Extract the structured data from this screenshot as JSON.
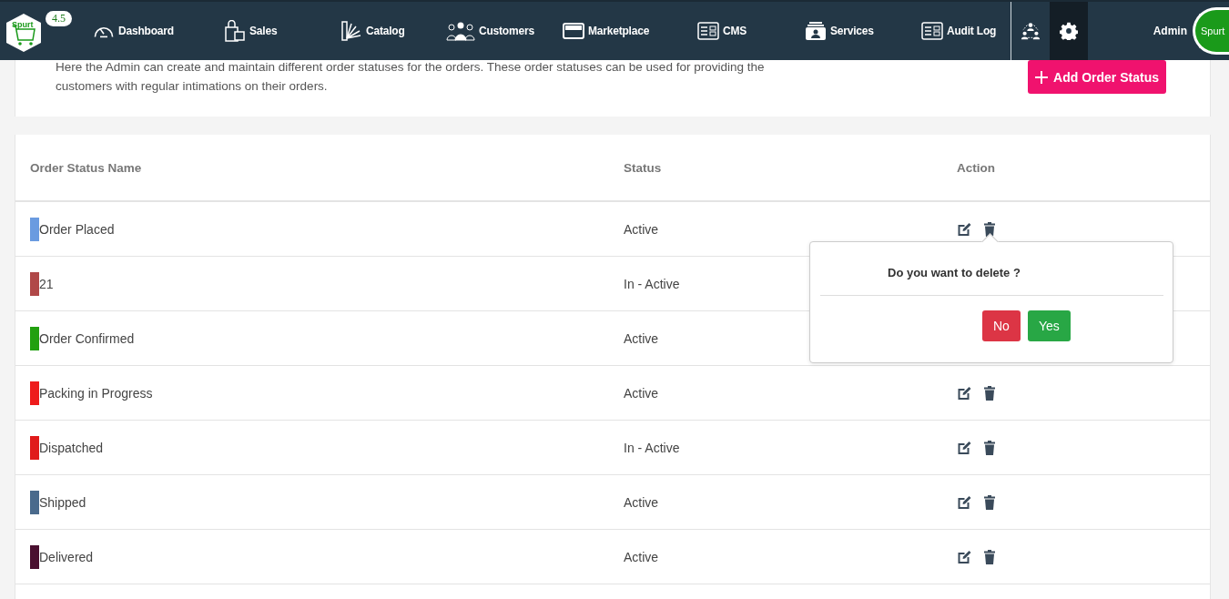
{
  "navbar": {
    "logo_text": "Spurt",
    "version": "4.5",
    "items": [
      {
        "kind": "dashboard",
        "label": "Dashboard"
      },
      {
        "kind": "bag",
        "label": "Sales"
      },
      {
        "kind": "swatch",
        "label": "Catalog"
      },
      {
        "kind": "people",
        "label": "Customers"
      },
      {
        "kind": "store",
        "label": "Marketplace"
      },
      {
        "kind": "doc",
        "label": "CMS"
      },
      {
        "kind": "service",
        "label": "Services"
      },
      {
        "kind": "doc",
        "label": "Audit Log"
      }
    ],
    "tools": [
      {
        "kind": "network",
        "selected": false
      },
      {
        "kind": "gear",
        "selected": true
      }
    ],
    "user": "Admin",
    "avatar_text": "Spurt"
  },
  "intro": {
    "description": "Here the Admin can create and maintain different order statuses for the orders. These order statuses can be used for providing the customers with regular intimations on their orders.",
    "add_button": "Add Order Status"
  },
  "table": {
    "columns": [
      "Order Status Name",
      "Status",
      "Action"
    ],
    "rows": [
      {
        "name": "Order Placed",
        "color": "#6a9be0",
        "status": "Active"
      },
      {
        "name": "21",
        "color": "#b04848",
        "status": "In - Active"
      },
      {
        "name": "Order Confirmed",
        "color": "#22a010",
        "status": "Active"
      },
      {
        "name": "Packing in Progress",
        "color": "#ee1c1c",
        "status": "Active"
      },
      {
        "name": "Dispatched",
        "color": "#e01b1b",
        "status": "In - Active"
      },
      {
        "name": "Shipped",
        "color": "#4a6a8c",
        "status": "Active"
      },
      {
        "name": "Delivered",
        "color": "#4a1030",
        "status": "Active"
      }
    ]
  },
  "delete_popup": {
    "question": "Do you want to delete ?",
    "no": "No",
    "yes": "Yes"
  }
}
